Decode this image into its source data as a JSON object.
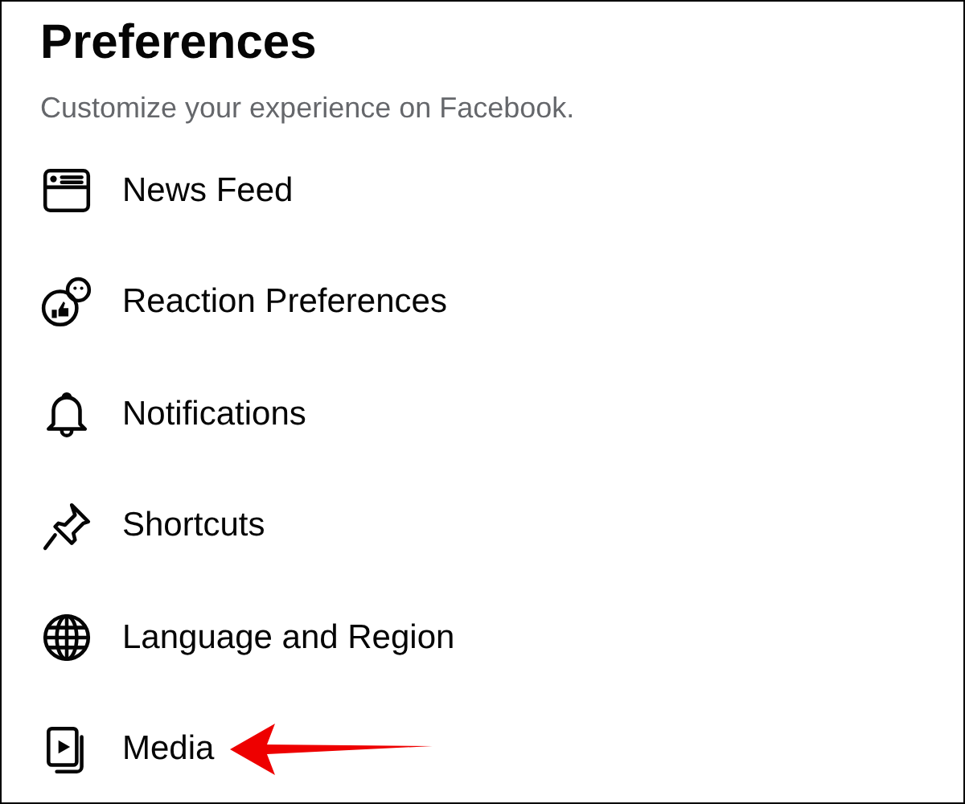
{
  "title": "Preferences",
  "subtitle": "Customize your experience on Facebook.",
  "items": [
    {
      "label": "News Feed",
      "pointed": false
    },
    {
      "label": "Reaction Preferences",
      "pointed": false
    },
    {
      "label": "Notifications",
      "pointed": false
    },
    {
      "label": "Shortcuts",
      "pointed": false
    },
    {
      "label": "Language and Region",
      "pointed": false
    },
    {
      "label": "Media",
      "pointed": true
    }
  ]
}
